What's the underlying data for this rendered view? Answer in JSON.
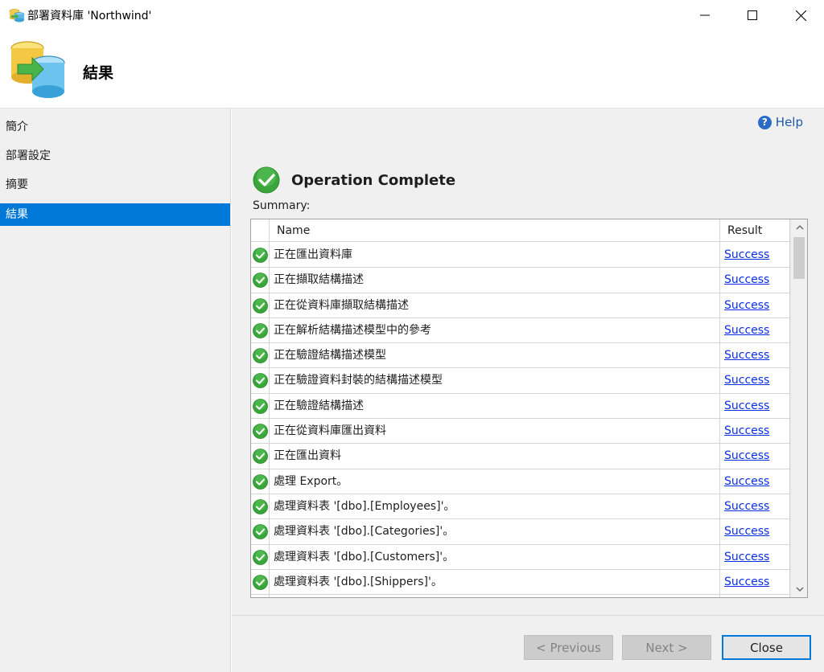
{
  "window": {
    "title": "部署資料庫 'Northwind'"
  },
  "header": {
    "title": "結果"
  },
  "nav": {
    "items": [
      {
        "label": "簡介",
        "active": false
      },
      {
        "label": "部署設定",
        "active": false
      },
      {
        "label": "摘要",
        "active": false
      },
      {
        "label": "結果",
        "active": true
      }
    ]
  },
  "main": {
    "help_label": "Help",
    "operation_title": "Operation Complete",
    "summary_label": "Summary:"
  },
  "grid": {
    "columns": [
      "Name",
      "Result"
    ],
    "rows": [
      {
        "name": "正在匯出資料庫",
        "result": "Success"
      },
      {
        "name": "正在擷取結構描述",
        "result": "Success"
      },
      {
        "name": "正在從資料庫擷取結構描述",
        "result": "Success"
      },
      {
        "name": "正在解析結構描述模型中的參考",
        "result": "Success"
      },
      {
        "name": "正在驗證結構描述模型",
        "result": "Success"
      },
      {
        "name": "正在驗證資料封裝的結構描述模型",
        "result": "Success"
      },
      {
        "name": "正在驗證結構描述",
        "result": "Success"
      },
      {
        "name": "正在從資料庫匯出資料",
        "result": "Success"
      },
      {
        "name": "正在匯出資料",
        "result": "Success"
      },
      {
        "name": "處理 Export。",
        "result": "Success"
      },
      {
        "name": "處理資料表 '[dbo].[Employees]'。",
        "result": "Success"
      },
      {
        "name": "處理資料表 '[dbo].[Categories]'。",
        "result": "Success"
      },
      {
        "name": "處理資料表 '[dbo].[Customers]'。",
        "result": "Success"
      },
      {
        "name": "處理資料表 '[dbo].[Shippers]'。",
        "result": "Success"
      }
    ]
  },
  "footer": {
    "previous_label": "< Previous",
    "next_label": "Next >",
    "close_label": "Close"
  },
  "colors": {
    "accent": "#0078d7",
    "success_green": "#3aa53a",
    "link": "#0a2ee0"
  }
}
